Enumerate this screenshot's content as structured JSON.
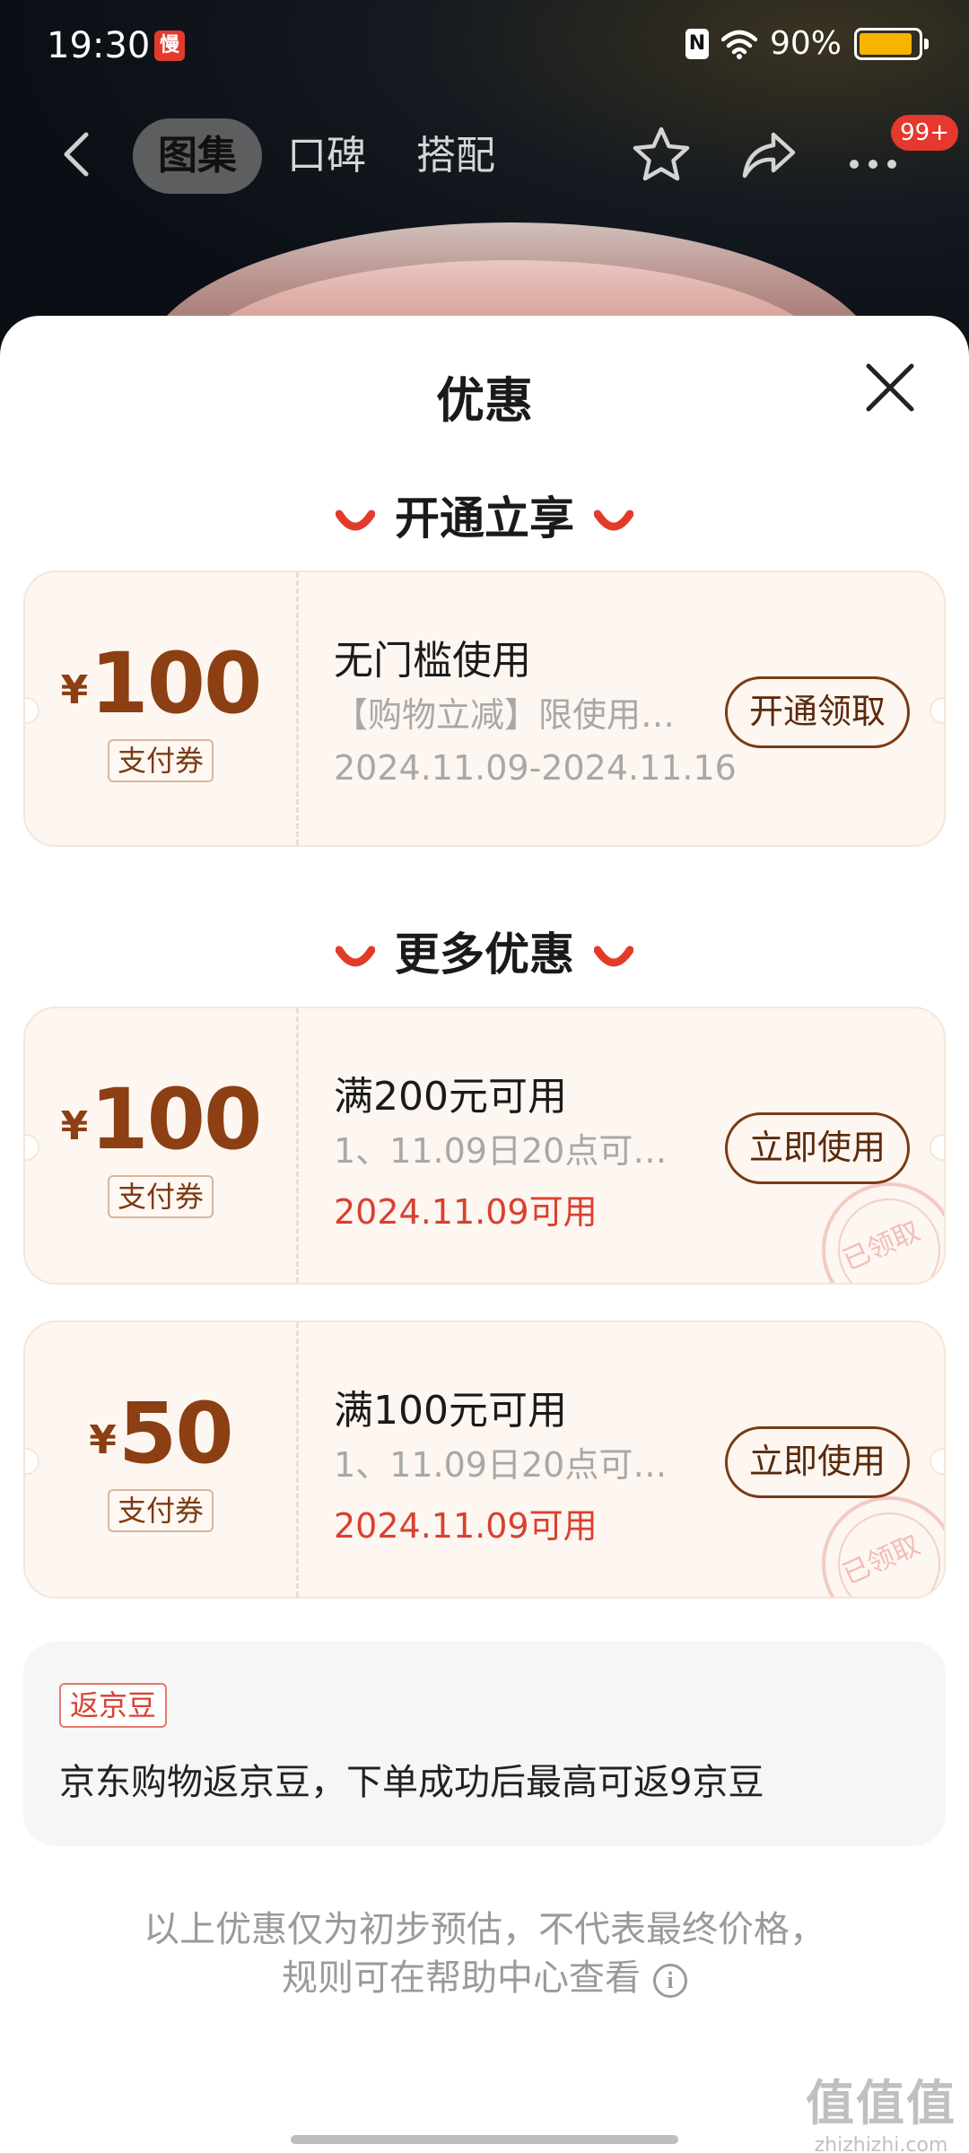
{
  "status_bar": {
    "time": "19:30",
    "app_icon": "慢",
    "nfc_icon": "N",
    "battery": "90%",
    "battery_level": 0.9
  },
  "nav": {
    "tabs": [
      {
        "label": "图集"
      },
      {
        "label": "口碑"
      },
      {
        "label": "搭配"
      }
    ],
    "badge": "99+"
  },
  "sheet": {
    "title": "优惠"
  },
  "sections": {
    "open_title": "开通立享",
    "more_title": "更多优惠"
  },
  "coupons": [
    {
      "currency": "¥",
      "amount": "100",
      "tag": "支付券",
      "title": "无门槛使用",
      "desc": "【购物立减】限使用…",
      "date": "2024.11.09-2024.11.16",
      "button": "开通领取"
    },
    {
      "currency": "¥",
      "amount": "100",
      "tag": "支付券",
      "title": "满200元可用",
      "desc": "1、11.09日20点可…",
      "date": "2024.11.09可用",
      "button": "立即使用",
      "stamp": "已领取"
    },
    {
      "currency": "¥",
      "amount": "50",
      "tag": "支付券",
      "title": "满100元可用",
      "desc": "1、11.09日20点可…",
      "date": "2024.11.09可用",
      "button": "立即使用",
      "stamp": "已领取"
    }
  ],
  "bean": {
    "tag": "返京豆",
    "text": "京东购物返京豆，下单成功后最高可返9京豆"
  },
  "footnote": {
    "line1": "以上优惠仅为初步预估，不代表最终价格，",
    "line2": "规则可在帮助中心查看"
  },
  "watermark": {
    "logo": "值值值",
    "url": "zhizhizhi.com"
  },
  "colors": {
    "accent_red": "#d9402f",
    "coupon_brown": "#8b3f12",
    "coupon_bg": "#fdf6f1"
  }
}
